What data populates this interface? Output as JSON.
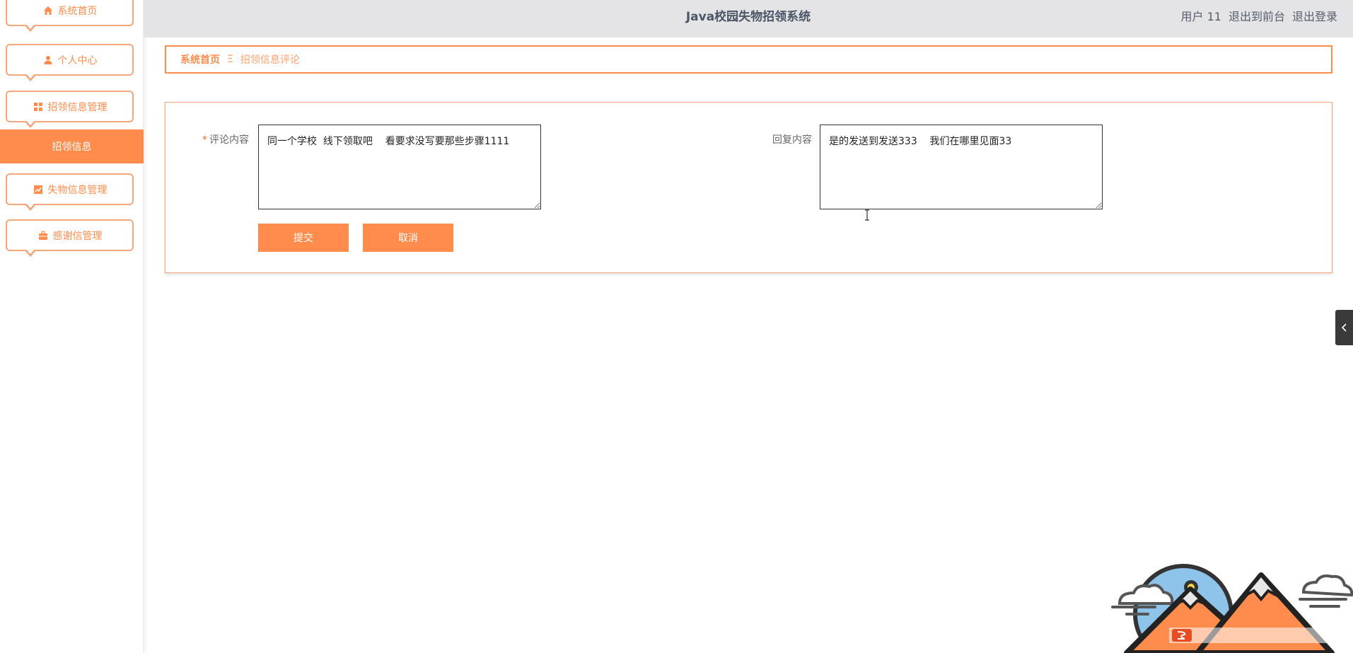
{
  "app": {
    "title": "Java校园失物招领系统"
  },
  "header": {
    "user_label": "用户 11",
    "to_front": "退出到前台",
    "logout": "退出登录"
  },
  "sidebar": {
    "items": [
      {
        "label": "系统首页",
        "icon": "home-icon"
      },
      {
        "label": "个人中心",
        "icon": "user-icon"
      },
      {
        "label": "招领信息管理",
        "icon": "grid-icon"
      },
      {
        "label": "失物信息管理",
        "icon": "chart-icon"
      },
      {
        "label": "感谢信管理",
        "icon": "briefcase-icon"
      }
    ],
    "active_sub": "招领信息"
  },
  "breadcrumb": {
    "home": "系统首页",
    "separator": "Ξ",
    "current": "招领信息评论"
  },
  "form": {
    "comment_label": "评论内容",
    "required_mark": "*",
    "comment_value": "同一个学校  线下领取吧    看要求没写要那些步骤1111",
    "reply_label": "回复内容",
    "reply_value": "是的发送到发送333    我们在哪里见面33",
    "submit": "提交",
    "cancel": "取消"
  },
  "colors": {
    "accent": "#ff8c4d",
    "header_bg": "#e4e4e6"
  }
}
